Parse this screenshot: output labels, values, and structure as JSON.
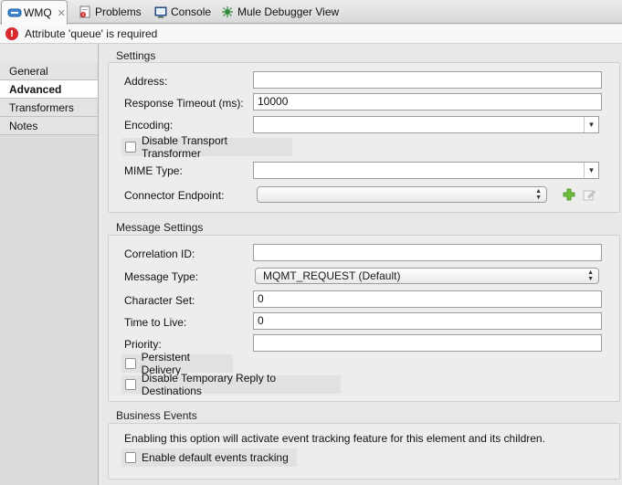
{
  "tabs": [
    {
      "label": "WMQ",
      "active": true,
      "icon": "wmq-endpoint-icon",
      "closable": true
    },
    {
      "label": "Problems",
      "active": false,
      "icon": "problems-icon"
    },
    {
      "label": "Console",
      "active": false,
      "icon": "console-icon"
    },
    {
      "label": "Mule Debugger View",
      "active": false,
      "icon": "debugger-icon"
    }
  ],
  "error": {
    "message": "Attribute 'queue' is required",
    "icon": "error-icon",
    "color": "#d9282e"
  },
  "sidebar": {
    "items": [
      {
        "label": "General",
        "active": false
      },
      {
        "label": "Advanced",
        "active": true
      },
      {
        "label": "Transformers",
        "active": false
      },
      {
        "label": "Notes",
        "active": false
      }
    ]
  },
  "settings": {
    "title": "Settings",
    "address_label": "Address:",
    "address_value": "",
    "response_timeout_label": "Response Timeout (ms):",
    "response_timeout_value": "10000",
    "encoding_label": "Encoding:",
    "encoding_value": "",
    "disable_transport_label": "Disable Transport Transformer",
    "disable_transport_checked": false,
    "mime_label": "MIME Type:",
    "mime_value": "",
    "connector_label": "Connector Endpoint:",
    "connector_value": ""
  },
  "message_settings": {
    "title": "Message Settings",
    "correlation_label": "Correlation ID:",
    "correlation_value": "",
    "message_type_label": "Message Type:",
    "message_type_value": "MQMT_REQUEST (Default)",
    "charset_label": "Character Set:",
    "charset_value": "0",
    "ttl_label": "Time to Live:",
    "ttl_value": "0",
    "priority_label": "Priority:",
    "priority_value": "",
    "persistent_label": "Persistent Delivery",
    "persistent_checked": false,
    "disable_temp_reply_label": "Disable Temporary Reply to Destinations",
    "disable_temp_reply_checked": false
  },
  "business_events": {
    "title": "Business Events",
    "description": "Enabling this option will activate event tracking feature for this element and its children.",
    "tracking_label": "Enable default events tracking",
    "tracking_checked": false
  }
}
